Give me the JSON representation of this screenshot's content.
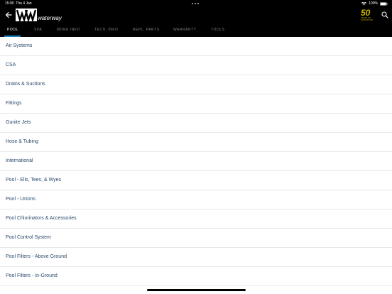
{
  "status_bar": {
    "time": "15:00",
    "date": "Thu 4 Jan",
    "battery": "100%"
  },
  "brand": {
    "name": "waterway",
    "anniversary_number": "50",
    "anniversary_text": "YEARS OF INNOVATION"
  },
  "tabs": [
    {
      "label": "POOL",
      "active": true
    },
    {
      "label": "SPA",
      "active": false
    },
    {
      "label": "MORE INFO",
      "active": false
    },
    {
      "label": "TECH. INFO",
      "active": false
    },
    {
      "label": "REPL. PARTS",
      "active": false
    },
    {
      "label": "WARRANTY",
      "active": false
    },
    {
      "label": "TOOLS",
      "active": false
    }
  ],
  "categories": [
    "Air Systems",
    "CSA",
    "Drains & Suctions",
    "Fittings",
    "Gunite Jets",
    "Hose & Tubing",
    "International",
    "Pool - Ells, Tees, & Wyes",
    "Pool - Unions",
    "Pool Chlorinators & Accessories",
    "Pool Control System",
    "Pool Filters - Above Ground",
    "Pool Filters - In-Ground"
  ],
  "colors": {
    "header_bg": "#000000",
    "accent": "#1c82c4",
    "gold": "#c8b400",
    "item_text": "#2a4a6d"
  },
  "icons": {
    "back": "back-arrow-icon",
    "search": "search-icon",
    "wifi": "wifi-icon",
    "battery": "battery-icon"
  }
}
